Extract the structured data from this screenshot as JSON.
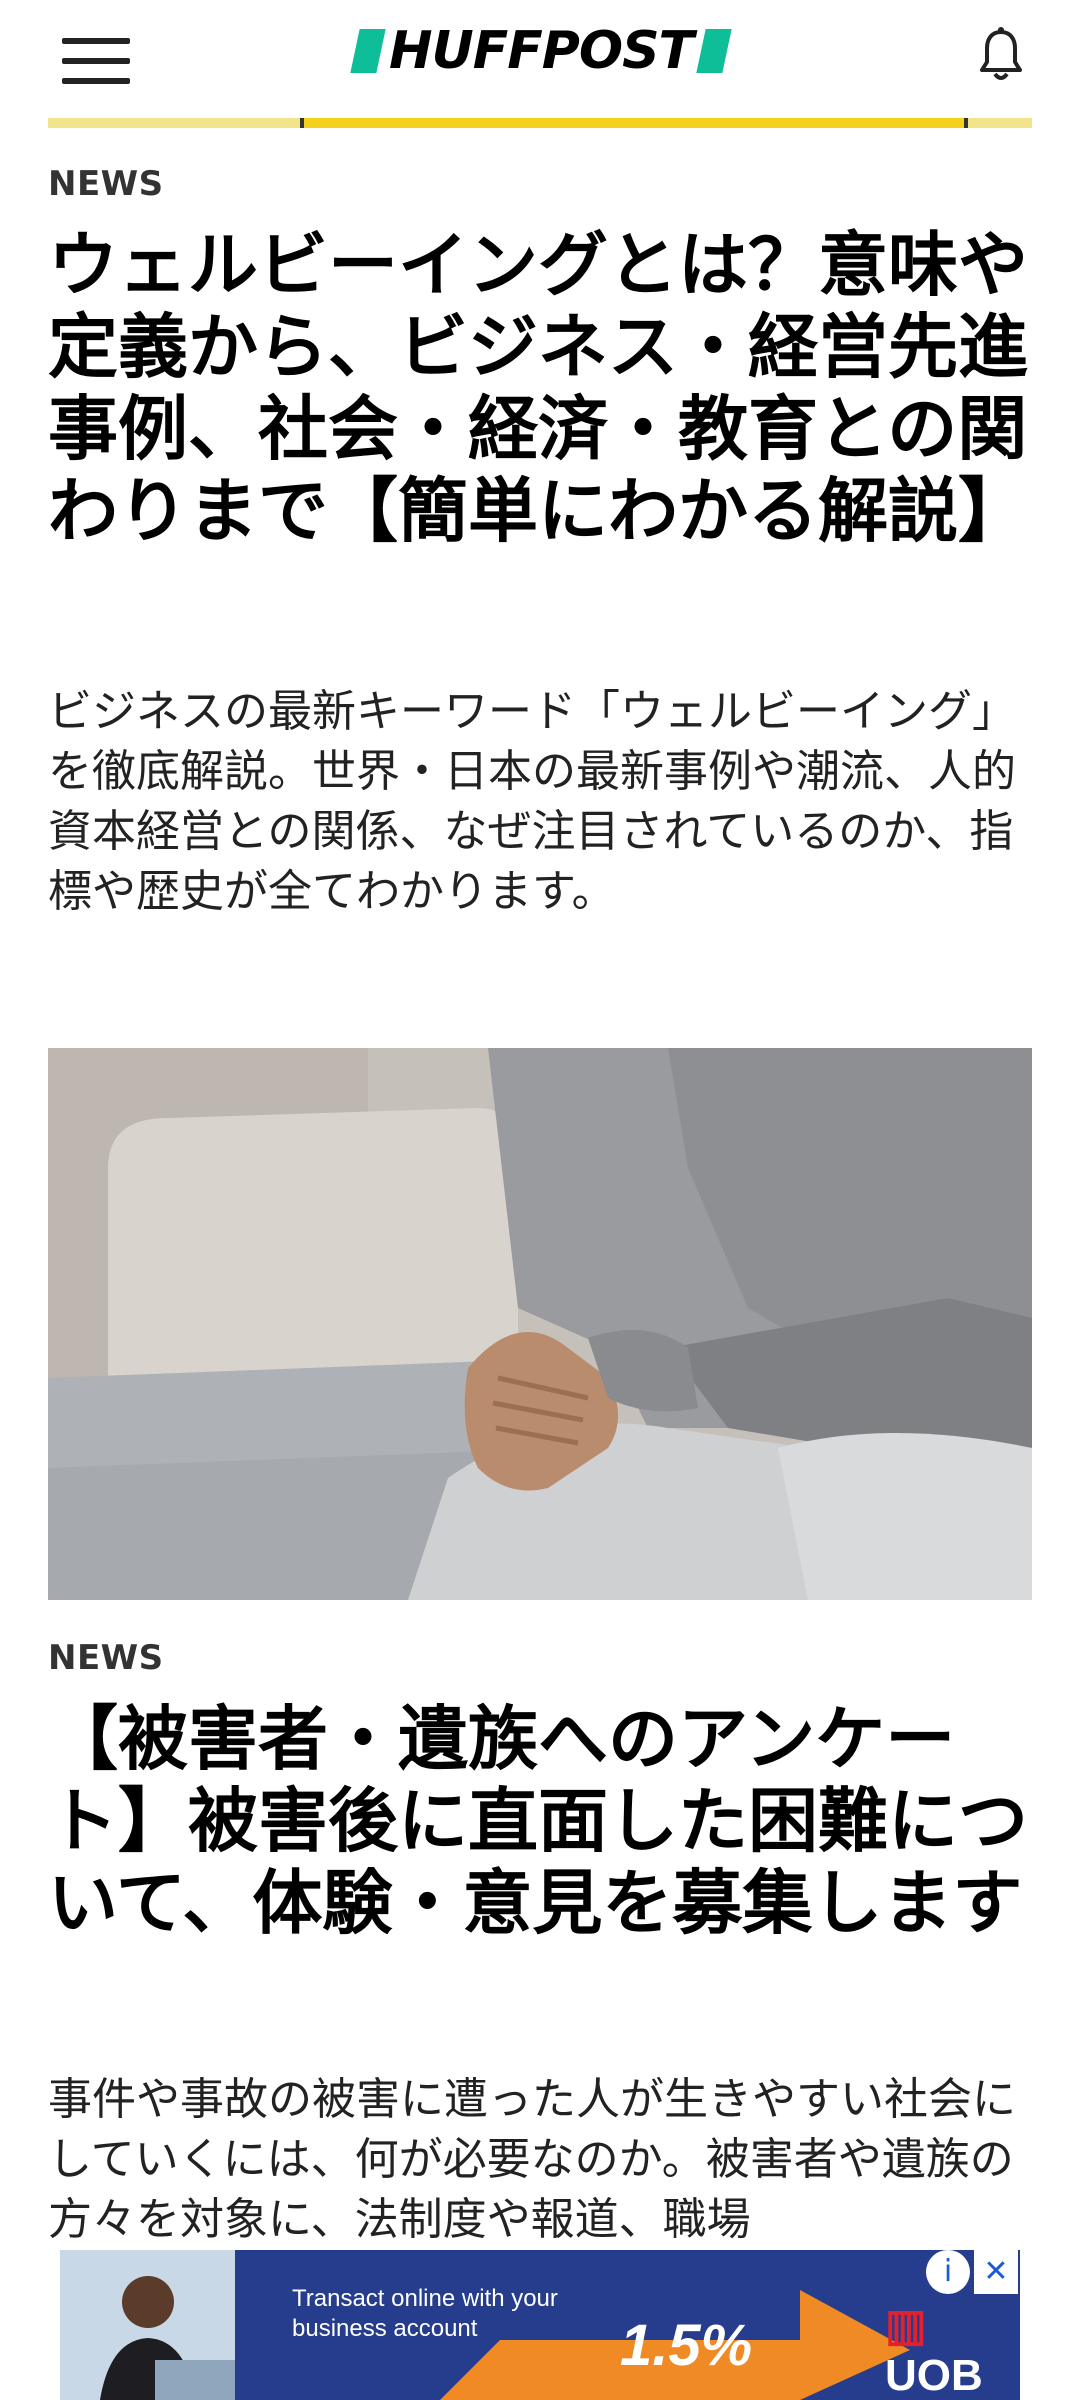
{
  "header": {
    "logo": "HUFFPOST",
    "menu_icon": "hamburger-menu-icon",
    "notification_icon": "bell-icon"
  },
  "articles": [
    {
      "section": "NEWS",
      "headline": "ウェルビーイングとは？意味や定義から、ビジネス・経営先進事例、社会・経済・教育との関わりまで【簡単にわかる解説】",
      "dek": "ビジネスの最新キーワード「ウェルビーイング」を徹底解説。世界・日本の最新事例や潮流、人的資本経営との関係、なぜ注目されているのか、指標や歴史が全てわかります。"
    },
    {
      "section": "NEWS",
      "image": "photo-clasped-hands-gray-sweater",
      "headline": "【被害者・遺族へのアンケート】被害後に直面した困難について、体験・意見を募集します",
      "dek": "事件や事故の被害に遭った人が生きやすい社会にしていくには、何が必要なのか。被害者や遺族の方々を対象に、法制度や報道、職場"
    },
    {
      "section": "",
      "headline": "",
      "dek": ""
    }
  ],
  "ad": {
    "line1": "Transact online with your",
    "line2": "business account",
    "rate": "1.5%",
    "brand": "UOB",
    "info_icon": "info-icon",
    "close_icon": "close-icon"
  },
  "colors": {
    "logo_accent": "#0dbe98",
    "ad_background": "#263c8c",
    "ad_brand_red": "#e2202e"
  }
}
